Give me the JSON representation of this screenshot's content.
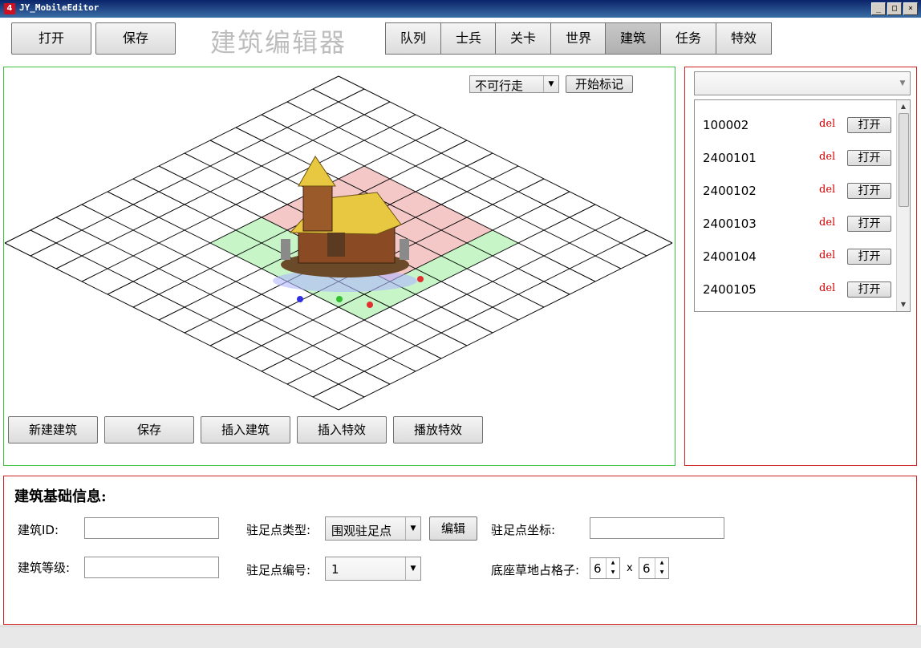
{
  "window": {
    "title": "JY_MobileEditor",
    "app_icon": "4"
  },
  "winbtns": {
    "min": "_",
    "max": "□",
    "close": "×"
  },
  "toolbar": {
    "open": "打开",
    "save": "保存",
    "title": "建筑编辑器"
  },
  "tabs": [
    "队列",
    "士兵",
    "关卡",
    "世界",
    "建筑",
    "任务",
    "特效"
  ],
  "active_tab": "建筑",
  "map": {
    "walk_select": "不可行走",
    "mark_button": "开始标记",
    "grid_size": 13
  },
  "map_buttons": {
    "new": "新建建筑",
    "save": "保存",
    "insert_building": "插入建筑",
    "insert_effect": "插入特效",
    "play_effect": "播放特效"
  },
  "right": {
    "search_value": "",
    "items": [
      {
        "id": "100002",
        "del": "del",
        "open": "打开"
      },
      {
        "id": "2400101",
        "del": "del",
        "open": "打开"
      },
      {
        "id": "2400102",
        "del": "del",
        "open": "打开"
      },
      {
        "id": "2400103",
        "del": "del",
        "open": "打开"
      },
      {
        "id": "2400104",
        "del": "del",
        "open": "打开"
      },
      {
        "id": "2400105",
        "del": "del",
        "open": "打开"
      }
    ]
  },
  "info": {
    "heading": "建筑基础信息:",
    "id_label": "建筑ID:",
    "id_value": "",
    "level_label": "建筑等级:",
    "level_value": "",
    "station_type_label": "驻足点类型:",
    "station_type_value": "围观驻足点",
    "edit_button": "编辑",
    "station_coord_label": "驻足点坐标:",
    "station_coord_value": "",
    "station_no_label": "驻足点编号:",
    "station_no_value": "1",
    "grid_label": "底座草地占格子:",
    "grid_w": "6",
    "grid_x": "x",
    "grid_h": "6"
  },
  "colors": {
    "green_tile": "#c8f5c8",
    "red_tile": "#f5c8c8",
    "panel_green": "#40c040",
    "panel_red": "#d02020"
  }
}
